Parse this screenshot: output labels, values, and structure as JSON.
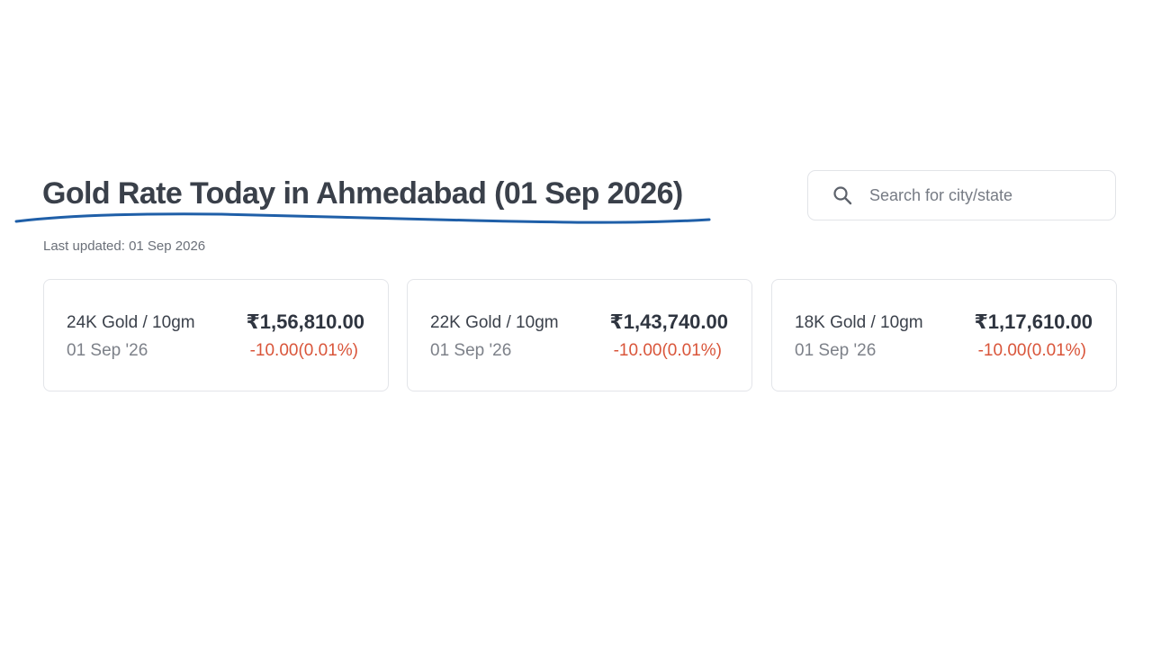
{
  "header": {
    "title": "Gold Rate Today in Ahmedabad (01 Sep 2026)",
    "last_updated": "Last updated: 01 Sep 2026",
    "underline_color": "#1f5fa8"
  },
  "search": {
    "icon": "search-icon",
    "placeholder": "Search for city/state",
    "value": ""
  },
  "rates": [
    {
      "label": "24K Gold / 10gm",
      "date": "01 Sep '26",
      "price": "₹1,56,810.00",
      "change": "-10.00(0.01%)"
    },
    {
      "label": "22K Gold / 10gm",
      "date": "01 Sep '26",
      "price": "₹1,43,740.00",
      "change": "-10.00(0.01%)"
    },
    {
      "label": "18K Gold / 10gm",
      "date": "01 Sep '26",
      "price": "₹1,17,610.00",
      "change": "-10.00(0.01%)"
    }
  ],
  "colors": {
    "negative_change": "#d9553a",
    "card_border": "#e3e5e9"
  }
}
